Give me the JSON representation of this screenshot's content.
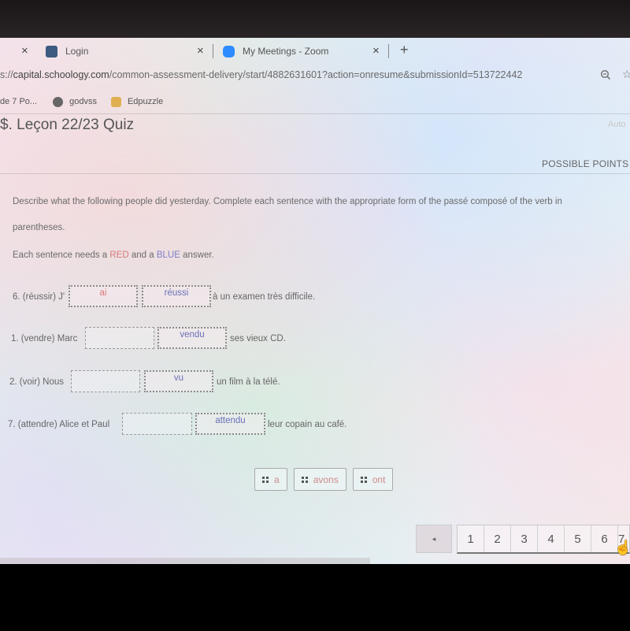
{
  "browser": {
    "tabs": [
      {
        "title": "",
        "close_label": "×"
      },
      {
        "title": "Login",
        "close_label": "×",
        "favicon_color": "#3d5a80"
      },
      {
        "title": "My Meetings - Zoom",
        "close_label": "×",
        "favicon_color": "#2d8cff"
      }
    ],
    "new_tab_label": "+",
    "url_prefix": "s://",
    "url_host": "capital.schoology.com",
    "url_path": "/common-assessment-delivery/start/4882631601?action=onresume&submissionId=513722442",
    "bookmarks": [
      {
        "label": "de 7 Po...",
        "icon": "none"
      },
      {
        "label": "godvss",
        "icon": "globe-icon"
      },
      {
        "label": "Edpuzzle",
        "icon": "edpuzzle-icon"
      }
    ]
  },
  "quiz": {
    "title": "$. Leçon 22/23 Quiz",
    "auto_label": "Auto",
    "points_label": "POSSIBLE POINTS",
    "instructions": "Describe what the following people did yesterday. Complete each sentence with the appropriate form of the passé composé of the verb in parentheses.",
    "requirement": {
      "prefix": "Each sentence needs a ",
      "red": "RED",
      "middle": " and a ",
      "blue": "BLUE",
      "suffix": " answer."
    },
    "questions": [
      {
        "label": "6. (réussir) J'",
        "red_answer": "ai",
        "blue_answer": "réussi",
        "after": "à un examen très difficile."
      },
      {
        "label": "1. (vendre) Marc",
        "red_answer": "",
        "blue_answer": "vendu",
        "after": "ses vieux CD."
      },
      {
        "label": "2. (voir) Nous",
        "red_answer": "",
        "blue_answer": "vu",
        "after": "un film à la télé."
      },
      {
        "label": "7. (attendre) Alice et Paul",
        "red_answer": "",
        "blue_answer": "attendu",
        "after": "leur copain au café."
      }
    ],
    "word_bank": [
      "a",
      "avons",
      "ont"
    ],
    "colors": {
      "red": "#d77a7a",
      "blue": "#7b7fc8"
    }
  },
  "pagination": {
    "prev_label": "◂",
    "pages": [
      "1",
      "2",
      "3",
      "4",
      "5",
      "6",
      "7"
    ]
  }
}
